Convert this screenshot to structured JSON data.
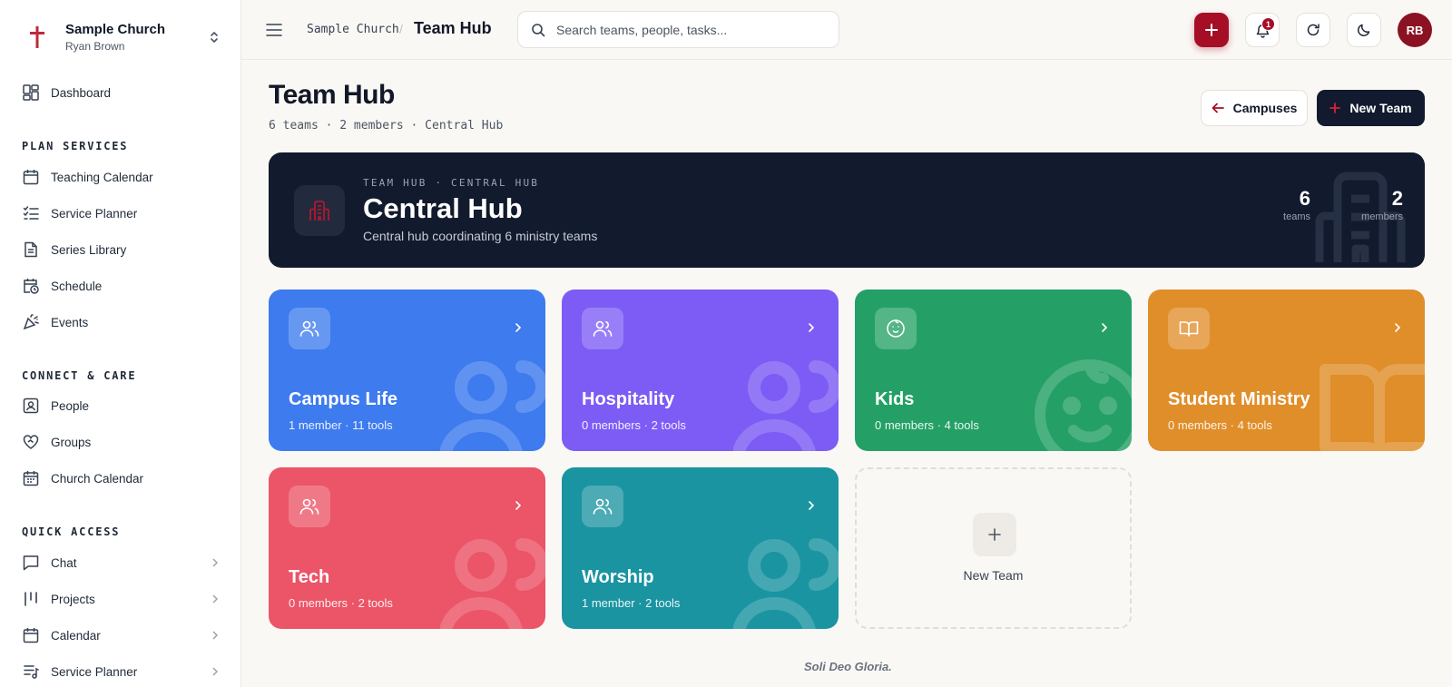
{
  "org": {
    "name": "Sample Church",
    "user": "Ryan Brown"
  },
  "sidebar": {
    "dashboard": "Dashboard",
    "sections": {
      "plan": "PLAN SERVICES",
      "connect": "CONNECT & CARE",
      "quick": "QUICK ACCESS"
    },
    "plan_items": [
      "Teaching Calendar",
      "Service Planner",
      "Series Library",
      "Schedule",
      "Events"
    ],
    "connect_items": [
      "People",
      "Groups",
      "Church Calendar"
    ],
    "quick_items": [
      "Chat",
      "Projects",
      "Calendar",
      "Service Planner"
    ]
  },
  "topbar": {
    "crumb_root": "Sample Church",
    "crumb_sep": "/",
    "crumb_current": "Team Hub",
    "search_placeholder": "Search teams, people, tasks...",
    "notification_count": "1",
    "avatar_initials": "RB"
  },
  "page": {
    "title": "Team Hub",
    "subtitle": "6 teams · 2 members · Central Hub",
    "campuses_label": "Campuses",
    "new_team_label": "New Team"
  },
  "hero": {
    "eyebrow": "TEAM HUB · CENTRAL HUB",
    "title": "Central Hub",
    "description": "Central hub coordinating 6 ministry teams",
    "teams_value": "6",
    "teams_label": "teams",
    "members_value": "2",
    "members_label": "members"
  },
  "teams": [
    {
      "name": "Campus Life",
      "meta": "1 member · 11 tools",
      "color": "#3d7bee",
      "icon": "users-icon"
    },
    {
      "name": "Hospitality",
      "meta": "0 members · 2 tools",
      "color": "#7d5cf5",
      "icon": "users-icon"
    },
    {
      "name": "Kids",
      "meta": "0 members · 4 tools",
      "color": "#24a066",
      "icon": "baby-icon"
    },
    {
      "name": "Student Ministry",
      "meta": "0 members · 4 tools",
      "color": "#e08e2a",
      "icon": "book-icon"
    },
    {
      "name": "Tech",
      "meta": "0 members · 2 tools",
      "color": "#ec5467",
      "icon": "users-icon"
    },
    {
      "name": "Worship",
      "meta": "1 member · 2 tools",
      "color": "#1a94a1",
      "icon": "users-icon"
    }
  ],
  "add_team_label": "New Team",
  "footer": "Soli Deo Gloria."
}
